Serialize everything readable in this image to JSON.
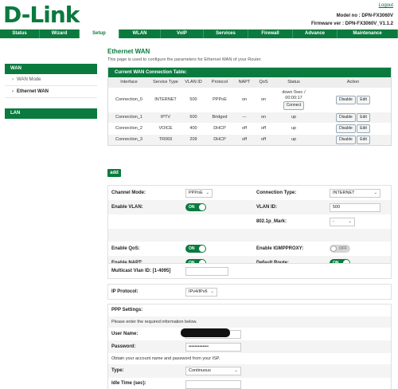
{
  "header": {
    "logo": "D-Link",
    "logout": "Logout",
    "model": "Model no : DPN-FX3060V",
    "firmware": "Firmware ver : DPN-FX3060V_V1.1.2"
  },
  "nav": [
    "Status",
    "Wizard",
    "Setup",
    "WLAN",
    "VoIP",
    "Services",
    "Firewall",
    "Advance",
    "Maintenance"
  ],
  "sidebar": {
    "wan": "WAN",
    "wan_mode": "WAN Mode",
    "ethernet_wan": "Ethernet WAN",
    "lan": "LAN"
  },
  "page": {
    "title": "Ethernet WAN",
    "description": "This page is used to configure the parameters for Ethernet WAN of your Router."
  },
  "conn_table": {
    "heading": "Current WAN Connection Table:",
    "columns": [
      "Interface",
      "Service Type",
      "VLAN ID",
      "Protocol",
      "NAPT",
      "QoS",
      "Status",
      "Action"
    ],
    "rows": [
      {
        "interface": "Connection_0",
        "service": "INTERNET",
        "vlan": "500",
        "protocol": "PPPoE",
        "napt": "on",
        "qos": "on",
        "status": "down 0sec / 00:00:17",
        "connect": "Connect",
        "disable": "Disable",
        "edit": "Edit"
      },
      {
        "interface": "Connection_1",
        "service": "IPTV",
        "vlan": "600",
        "protocol": "Bridged",
        "napt": "---",
        "qos": "on",
        "status": "up",
        "disable": "Disable",
        "edit": "Edit"
      },
      {
        "interface": "Connection_2",
        "service": "VOICE",
        "vlan": "400",
        "protocol": "DHCP",
        "napt": "off",
        "qos": "off",
        "status": "up",
        "disable": "Disable",
        "edit": "Edit"
      },
      {
        "interface": "Connection_3",
        "service": "TR069",
        "vlan": "209",
        "protocol": "DHCP",
        "napt": "off",
        "qos": "off",
        "status": "up",
        "disable": "Disable",
        "edit": "Edit"
      }
    ],
    "add_label": "add"
  },
  "form": {
    "channel_mode_label": "Channel Mode:",
    "channel_mode_value": "PPPoE",
    "connection_type_label": "Connection Type:",
    "connection_type_value": "INTERNET",
    "enable_vlan_label": "Enable VLAN:",
    "enable_vlan_state": "ON",
    "vlan_id_label": "VLAN ID:",
    "vlan_id_value": "500",
    "mark_label": "802.1p_Mark:",
    "mark_value": "-",
    "enable_qos_label": "Enable QoS:",
    "enable_qos_state": "ON",
    "igmp_label": "Enable IGMPPROXY:",
    "igmp_state": "OFF",
    "napt_label": "Enable NAPT:",
    "napt_state": "ON",
    "default_route_label": "Default Route:",
    "default_route_state": "ON"
  },
  "multicast": {
    "label": "Multicast Vlan ID: [1-4095]",
    "value": ""
  },
  "ip_protocol": {
    "label": "IP Protocol:",
    "value": "IPv4/IPv6"
  },
  "ppp": {
    "heading": "PPP Settings:",
    "hint": "Please enter the required information below.",
    "username_label": "User Name:",
    "password_label": "Password:",
    "password_value": "•••••••••••••",
    "obtain_hint": "Obtain your account name and password from your ISP.",
    "type_label": "Type:",
    "type_value": "Continuous",
    "idle_label": "Idle Time (sec):"
  }
}
